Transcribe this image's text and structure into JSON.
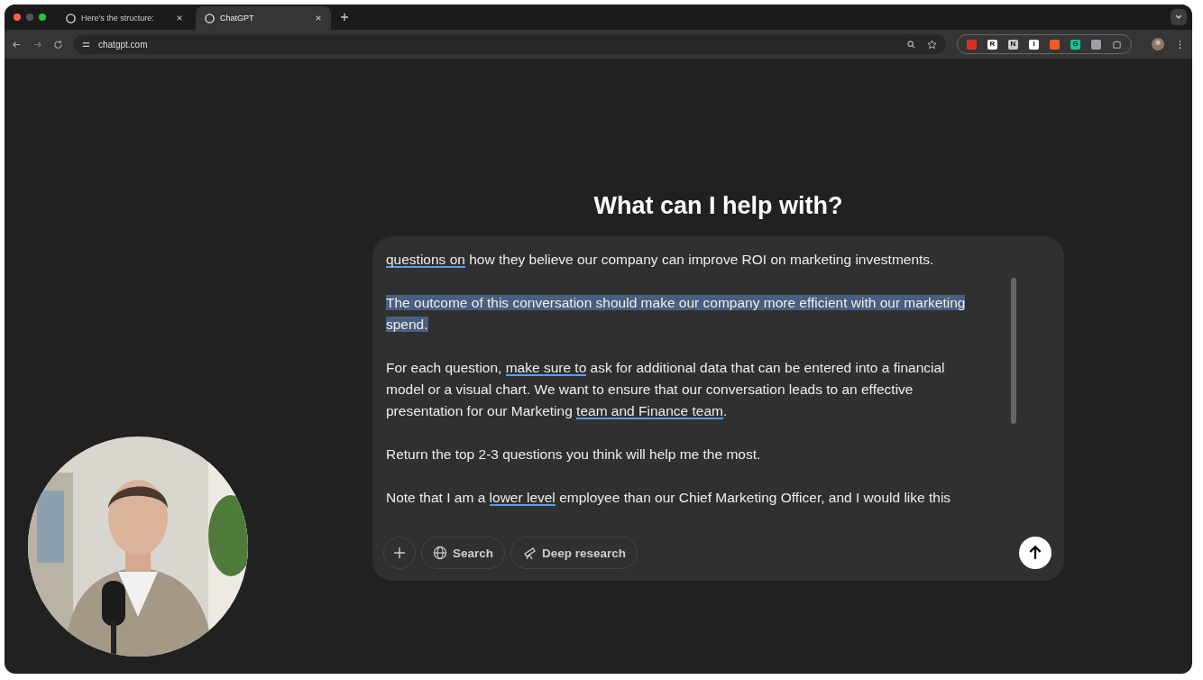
{
  "tabs": [
    {
      "title": "Here's the structure:",
      "selected": false
    },
    {
      "title": "ChatGPT",
      "selected": true
    }
  ],
  "address": "chatgpt.com",
  "extensions": [
    {
      "color": "#d93025"
    },
    {
      "color": "#ffffff",
      "glyph": "R"
    },
    {
      "color": "#cccccc",
      "glyph": "N"
    },
    {
      "color": "#ffffff",
      "glyph": "I"
    },
    {
      "color": "#f05a28"
    },
    {
      "color": "#15c39a",
      "glyph": "G"
    },
    {
      "color": "#9aa0a6"
    }
  ],
  "heading": "What can I help with?",
  "composer": {
    "paragraphs": [
      {
        "selected": false,
        "segments": [
          {
            "text": "questions on",
            "underlined": true
          },
          {
            "text": " how they believe our company can improve ROI on marketing investments.",
            "underlined": false
          }
        ]
      },
      {
        "selected": true,
        "segments": [
          {
            "text": "The outcome of this conversation should make our company more efficient with our marketing spend.",
            "underlined": false
          }
        ]
      },
      {
        "selected": false,
        "segments": [
          {
            "text": "For each question, ",
            "underlined": false
          },
          {
            "text": "make sure to",
            "underlined": true
          },
          {
            "text": " ask for additional data that can be entered into a financial model or a visual chart. We want to ensure that our conversation leads to an effective presentation for our Marketing ",
            "underlined": false
          },
          {
            "text": "team and Finance team",
            "underlined": true
          },
          {
            "text": ".",
            "underlined": false
          }
        ]
      },
      {
        "selected": false,
        "segments": [
          {
            "text": "Return the top 2-3 questions you think will help me the most.",
            "underlined": false
          }
        ]
      },
      {
        "selected": false,
        "segments": [
          {
            "text": "Note that I am a ",
            "underlined": false
          },
          {
            "text": "lower level",
            "underlined": true
          },
          {
            "text": " employee than our Chief Marketing Officer, and I would like this",
            "underlined": false
          }
        ]
      }
    ],
    "tools": [
      {
        "label": "Search",
        "kind": "globe"
      },
      {
        "label": "Deep research",
        "kind": "telescope"
      }
    ]
  }
}
